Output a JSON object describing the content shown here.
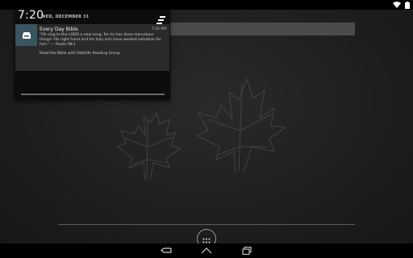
{
  "status_bar": {
    "wifi_icon": "wifi-icon",
    "battery_icon": "battery-icon"
  },
  "notification_shade": {
    "clock": "7:20",
    "date": "WED, DECEMBER 31",
    "clear_all_icon": "clear-all-icon"
  },
  "notification": {
    "app_icon": "bible-app-icon",
    "title": "Every Day Bible",
    "time": "7:20 PM",
    "body": "\"Oh sing to the LORD a new song, for he has done marvelous things! His right hand and his holy arm have worked salvation for him.\" — Psalm 98:1",
    "summary": "Read the Bible with Faithlife Reading Group"
  },
  "launcher": {
    "all_apps_icon": "all-apps-icon"
  },
  "nav_bar": {
    "back_icon": "back-icon",
    "home_icon": "home-icon",
    "recents_icon": "recents-icon"
  },
  "colors": {
    "notification_icon_bg": "#3a5560",
    "shade_bg": "#0c0c0c",
    "notification_bg": "#2a2a2a"
  }
}
